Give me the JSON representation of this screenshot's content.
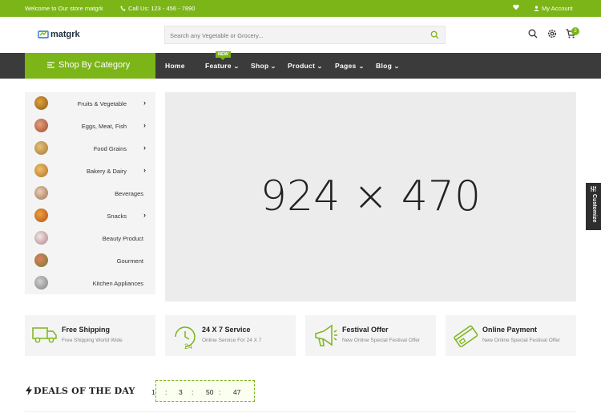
{
  "topbar": {
    "welcome": "Welcome to Our store matgrk",
    "call": "Call Us: 123 - 456 - 7890",
    "account": "My Account"
  },
  "header": {
    "logo": "matgrk",
    "search_placeholder": "Search any Vegetable or Grocery...",
    "cart_count": "2"
  },
  "nav": {
    "category_button": "Shop By Category",
    "badge": "NEW",
    "items": [
      {
        "label": "Home"
      },
      {
        "label": "Feature"
      },
      {
        "label": "Shop"
      },
      {
        "label": "Product"
      },
      {
        "label": "Pages"
      },
      {
        "label": "Blog"
      }
    ]
  },
  "sidebar": {
    "items": [
      {
        "label": "Fruits & Vegetable"
      },
      {
        "label": "Eggs, Meat, Fish"
      },
      {
        "label": "Food Grains"
      },
      {
        "label": "Bakery & Dairy"
      },
      {
        "label": "Beverages"
      },
      {
        "label": "Snacks"
      },
      {
        "label": "Beauty Product"
      },
      {
        "label": "Gourment"
      },
      {
        "label": "Kitchen Appliances"
      }
    ]
  },
  "banner": {
    "placeholder_text": "924 × 470"
  },
  "customize": "Customize",
  "features": [
    {
      "title": "Free Shipping",
      "subtitle": "Free Shipping World Wide",
      "icon": "truck-icon"
    },
    {
      "title": "24 X 7 Service",
      "subtitle": "Online Service For 24 X 7",
      "icon": "clock-24-icon"
    },
    {
      "title": "Festival Offer",
      "subtitle": "New Online Special Festival Offer",
      "icon": "megaphone-icon"
    },
    {
      "title": "Online Payment",
      "subtitle": "New Online Special Festival Offer",
      "icon": "credit-card-icon"
    }
  ],
  "deals": {
    "title": "DEALS OF THE DAY",
    "timer": {
      "days": "1",
      "hours": "3",
      "minutes": "50",
      "seconds": "47",
      "sep": ":"
    }
  },
  "colors": {
    "accent": "#7cb518",
    "nav_bg": "#3b3b3b",
    "panel_bg": "#f4f4f4"
  }
}
